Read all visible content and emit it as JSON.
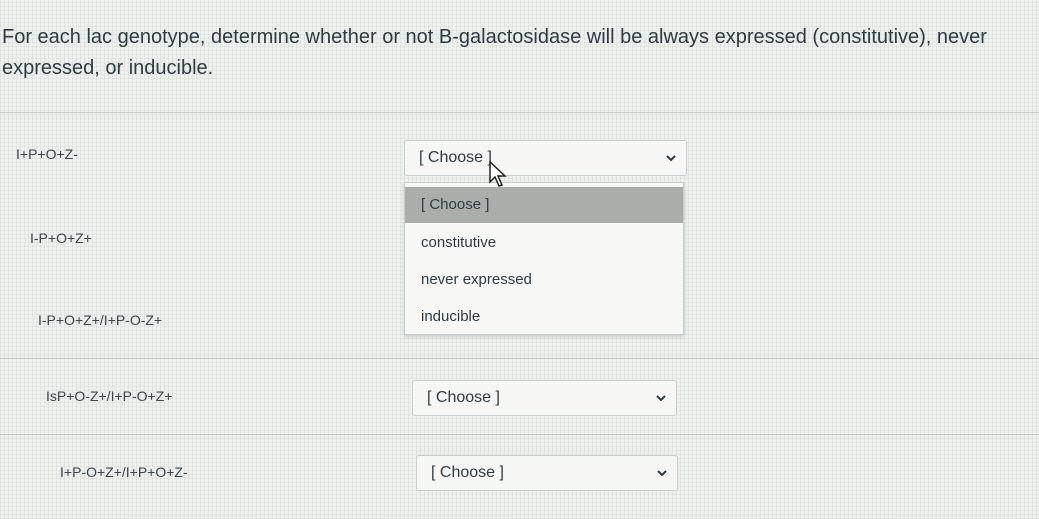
{
  "question": {
    "prompt": "For each lac genotype, determine whether or not B-galactosidase will be always expressed (constitutive), never expressed, or inducible."
  },
  "rows": [
    {
      "genotype": "I+P+O+Z-",
      "selected": "[ Choose ]"
    },
    {
      "genotype": "I-P+O+Z+",
      "selected": "[ Choose ]"
    },
    {
      "genotype": "I-P+O+Z+/I+P-O-Z+",
      "selected": "[ Choose ]"
    },
    {
      "genotype": "IsP+O-Z+/I+P-O+Z+",
      "selected": "[ Choose ]"
    },
    {
      "genotype": "I+P-O+Z+/I+P+O+Z-",
      "selected": "[ Choose ]"
    }
  ],
  "dropdown": {
    "open_for_row": 1,
    "options": [
      "[ Choose ]",
      "constitutive",
      "never expressed",
      "inducible"
    ],
    "highlighted_index": 0
  },
  "icons": {
    "select_arrow": "chevron-down-icon",
    "cursor": "mouse-pointer-icon"
  },
  "colors": {
    "text": "#2d3b45",
    "highlight": "#a9aeab",
    "border": "#c7cdd1"
  }
}
